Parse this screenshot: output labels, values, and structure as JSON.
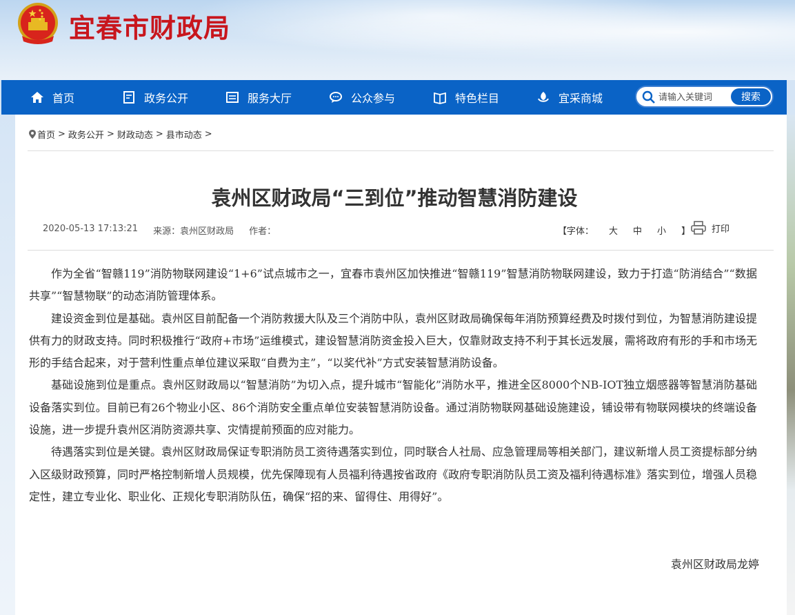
{
  "header": {
    "site_title": "宜春市财政局"
  },
  "nav": {
    "items": [
      {
        "label": "首页",
        "icon": "home-icon"
      },
      {
        "label": "政务公开",
        "icon": "document-icon"
      },
      {
        "label": "服务大厅",
        "icon": "list-icon"
      },
      {
        "label": "公众参与",
        "icon": "chat-icon"
      },
      {
        "label": "特色栏目",
        "icon": "book-icon"
      },
      {
        "label": "宜采商城",
        "icon": "leaf-icon"
      }
    ],
    "search": {
      "placeholder": "请输入关键词",
      "button_label": "搜索"
    }
  },
  "breadcrumb": {
    "items": [
      "首页",
      "政务公开",
      "财政动态",
      "县市动态"
    ]
  },
  "article": {
    "title": "袁州区财政局“三到位”推动智慧消防建设",
    "date": "2020-05-13 17:13:21",
    "source": "来源：袁州区财政局",
    "author_label": "作者：",
    "font_label": "【字体：",
    "font_large": "大",
    "font_medium": "中",
    "font_small": "小",
    "font_close": "】",
    "print_label": "打印",
    "paragraphs": [
      "作为全省“智赣119”消防物联网建设“1+6”试点城市之一，宜春市袁州区加快推进“智赣119”智慧消防物联网建设，致力于打造“防消结合”“数据共享”“智慧物联”的动态消防管理体系。",
      "建设资金到位是基础。袁州区目前配备一个消防救援大队及三个消防中队，袁州区财政局确保每年消防预算经费及时拨付到位，为智慧消防建设提供有力的财政支持。同时积极推行“政府+市场”运维模式，建设智慧消防资金投入巨大，仅靠财政支持不利于其长远发展，需将政府有形的手和市场无形的手结合起来，对于营利性重点单位建议采取“自费为主”，“以奖代补”方式安装智慧消防设备。",
      "基础设施到位是重点。袁州区财政局以“智慧消防”为切入点，提升城市“智能化”消防水平，推进全区8000个NB-IOT独立烟感器等智慧消防基础设备落实到位。目前已有26个物业小区、86个消防安全重点单位安装智慧消防设备。通过消防物联网基础设施建设，铺设带有物联网模块的终端设备设施，进一步提升袁州区消防资源共享、灾情提前预面的应对能力。",
      "待遇落实到位是关键。袁州区财政局保证专职消防员工资待遇落实到位，同时联合人社局、应急管理局等相关部门，建议新增人员工资提标部分纳入区级财政预算，同时严格控制新增人员规模，优先保障现有人员福利待遇按省政府《政府专职消防队员工资及福利待遇标准》落实到位，增强人员稳定性，建立专业化、职业化、正规化专职消防队伍，确保“招的来、留得住、用得好”。"
    ],
    "signature": "袁州区财政局龙婷"
  },
  "colors": {
    "nav_bg": "#0a63c6",
    "title_red": "#c8161d"
  }
}
